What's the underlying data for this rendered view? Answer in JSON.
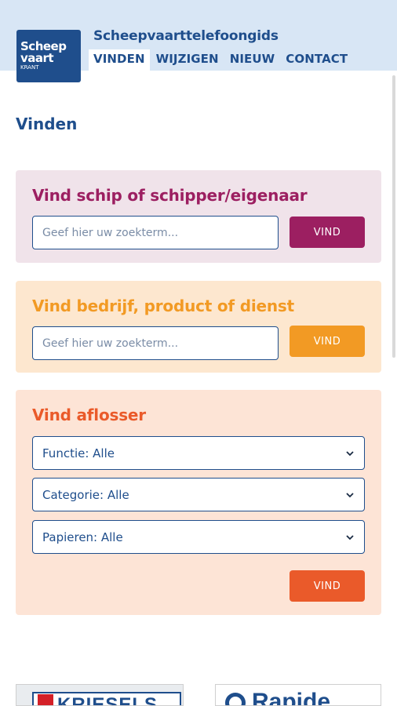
{
  "header": {
    "logo": {
      "line1": "Scheep",
      "line2": "vaart",
      "line3": "KRANT"
    },
    "site_title": "Scheepvaarttelefoongids",
    "nav": [
      {
        "label": "VINDEN",
        "active": true
      },
      {
        "label": "WIJZIGEN",
        "active": false
      },
      {
        "label": "NIEUW",
        "active": false
      },
      {
        "label": "CONTACT",
        "active": false
      }
    ]
  },
  "page_title": "Vinden",
  "ship_search": {
    "title": "Vind schip of schipper/eigenaar",
    "placeholder": "Geef hier uw zoekterm...",
    "button": "VIND",
    "accent": "#9c1f61"
  },
  "company_search": {
    "title": "Vind bedrijf, product of dienst",
    "placeholder": "Geef hier uw zoekterm...",
    "button": "VIND",
    "accent": "#f29a24"
  },
  "relief_search": {
    "title": "Vind aflosser",
    "selects": [
      {
        "value": "Functie: Alle"
      },
      {
        "value": "Categorie: Alle"
      },
      {
        "value": "Papieren: Alle"
      }
    ],
    "button": "VIND",
    "accent": "#ea5a2a"
  },
  "banners": [
    {
      "brand": "KRIESELS",
      "icon": "kriesels-logo-icon"
    },
    {
      "brand": "Rapide",
      "icon": "rapide-logo-icon"
    }
  ],
  "colors": {
    "primary": "#1f4e8c",
    "header_bg": "#d8e6f5"
  }
}
